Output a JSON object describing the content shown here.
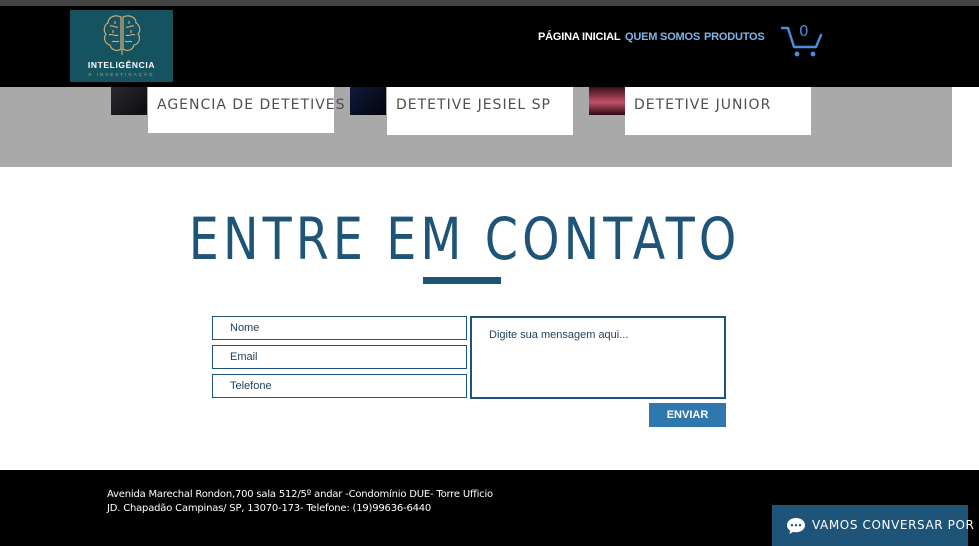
{
  "header": {
    "logo": {
      "title": "INTELIGÊNCIA",
      "subtitle": "E INVESTIGAÇÃO"
    },
    "nav": [
      {
        "label": "PÁGINA INICIAL",
        "color": "#ffffff"
      },
      {
        "label": "QUEM SOMOS",
        "color": "#7fb4e6"
      },
      {
        "label": "PRODUTOS",
        "color": "#7fb4e6"
      }
    ],
    "cart": {
      "count": "0",
      "color": "#4a90d9"
    }
  },
  "cards": [
    {
      "label": "Agencia de Detetives STDI"
    },
    {
      "label": "DETETIVE JESIEL SP"
    },
    {
      "label": "DETETIVE JUNIOR"
    }
  ],
  "contact": {
    "title": "ENTRE EM CONTATO",
    "fields": [
      {
        "placeholder": "Nome"
      },
      {
        "placeholder": "Email"
      },
      {
        "placeholder": "Telefone"
      }
    ],
    "message_placeholder": "Digite sua mensagem aqui...",
    "send_label": "ENVIAR"
  },
  "footer": {
    "address_line1": "Avenida Marechal Rondon,700 sala 512/5º andar -Condomínio DUE- Torre Ufficio",
    "address_line2": "JD. Chapadão Campinas/ SP, 13070-173- Telefone: (19)99636-6440"
  },
  "chat": {
    "label": "Vamos conversar por chat",
    "icon": "chat-bubble-icon"
  },
  "colors": {
    "accent": "#1e5478",
    "button": "#2e78ad",
    "band": "#a9a9a9"
  }
}
